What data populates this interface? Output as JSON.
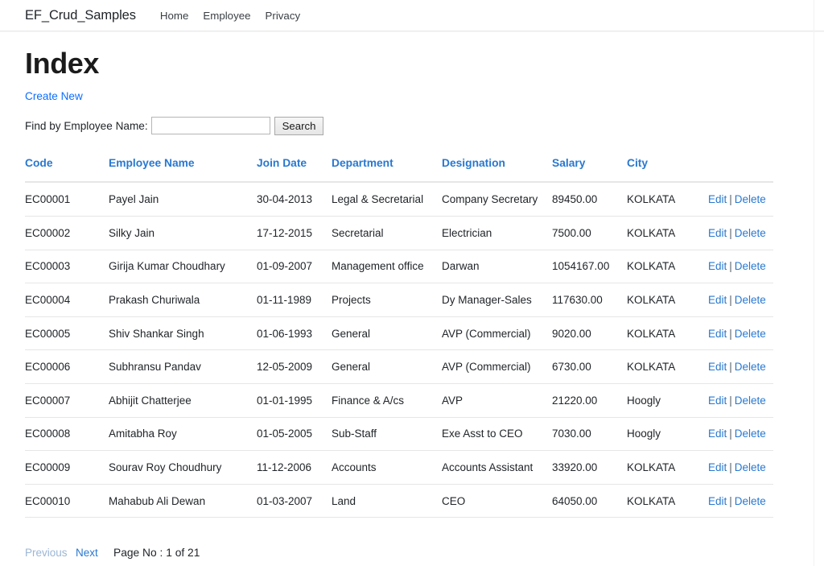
{
  "navbar": {
    "brand": "EF_Crud_Samples",
    "links": [
      {
        "label": "Home"
      },
      {
        "label": "Employee"
      },
      {
        "label": "Privacy"
      }
    ]
  },
  "main": {
    "title": "Index",
    "create_new_label": "Create New",
    "search": {
      "label": "Find by Employee Name:",
      "value": "",
      "placeholder": "",
      "button_label": "Search"
    },
    "table": {
      "columns": [
        {
          "key": "code",
          "label": "Code"
        },
        {
          "key": "name",
          "label": "Employee Name"
        },
        {
          "key": "join_date",
          "label": "Join Date"
        },
        {
          "key": "department",
          "label": "Department"
        },
        {
          "key": "designation",
          "label": "Designation"
        },
        {
          "key": "salary",
          "label": "Salary"
        },
        {
          "key": "city",
          "label": "City"
        }
      ],
      "action_labels": {
        "edit": "Edit",
        "separator": "|",
        "delete": "Delete"
      },
      "rows": [
        {
          "code": "EC00001",
          "name": "Payel Jain",
          "join_date": "30-04-2013",
          "department": "Legal & Secretarial",
          "designation": "Company Secretary",
          "salary": "89450.00",
          "city": "KOLKATA"
        },
        {
          "code": "EC00002",
          "name": "Silky Jain",
          "join_date": "17-12-2015",
          "department": "Secretarial",
          "designation": "Electrician",
          "salary": "7500.00",
          "city": "KOLKATA"
        },
        {
          "code": "EC00003",
          "name": "Girija Kumar Choudhary",
          "join_date": "01-09-2007",
          "department": "Management office",
          "designation": "Darwan",
          "salary": "1054167.00",
          "city": "KOLKATA"
        },
        {
          "code": "EC00004",
          "name": "Prakash Churiwala",
          "join_date": "01-11-1989",
          "department": "Projects",
          "designation": "Dy Manager-Sales",
          "salary": "117630.00",
          "city": "KOLKATA"
        },
        {
          "code": "EC00005",
          "name": "Shiv Shankar Singh",
          "join_date": "01-06-1993",
          "department": "General",
          "designation": "AVP (Commercial)",
          "salary": "9020.00",
          "city": "KOLKATA"
        },
        {
          "code": "EC00006",
          "name": "Subhransu Pandav",
          "join_date": "12-05-2009",
          "department": "General",
          "designation": "AVP (Commercial)",
          "salary": "6730.00",
          "city": "KOLKATA"
        },
        {
          "code": "EC00007",
          "name": "Abhijit Chatterjee",
          "join_date": "01-01-1995",
          "department": "Finance & A/cs",
          "designation": "AVP",
          "salary": "21220.00",
          "city": "Hoogly"
        },
        {
          "code": "EC00008",
          "name": "Amitabha Roy",
          "join_date": "01-05-2005",
          "department": "Sub-Staff",
          "designation": "Exe Asst to CEO",
          "salary": "7030.00",
          "city": "Hoogly"
        },
        {
          "code": "EC00009",
          "name": "Sourav Roy Choudhury",
          "join_date": "11-12-2006",
          "department": "Accounts",
          "designation": "Accounts Assistant",
          "salary": "33920.00",
          "city": "KOLKATA"
        },
        {
          "code": "EC00010",
          "name": "Mahabub Ali Dewan",
          "join_date": "01-03-2007",
          "department": "Land",
          "designation": "CEO",
          "salary": "64050.00",
          "city": "KOLKATA"
        }
      ]
    },
    "pager": {
      "previous_label": "Previous",
      "next_label": "Next",
      "page_info": "Page No : 1 of 21",
      "current_page": 1,
      "total_pages": 21,
      "previous_enabled": false,
      "next_enabled": true
    }
  },
  "colors": {
    "link": "#2878d0",
    "link_alt": "#0d6efd",
    "link_disabled": "#9bb6d6",
    "text": "#212529",
    "border": "#e6e6e6"
  }
}
